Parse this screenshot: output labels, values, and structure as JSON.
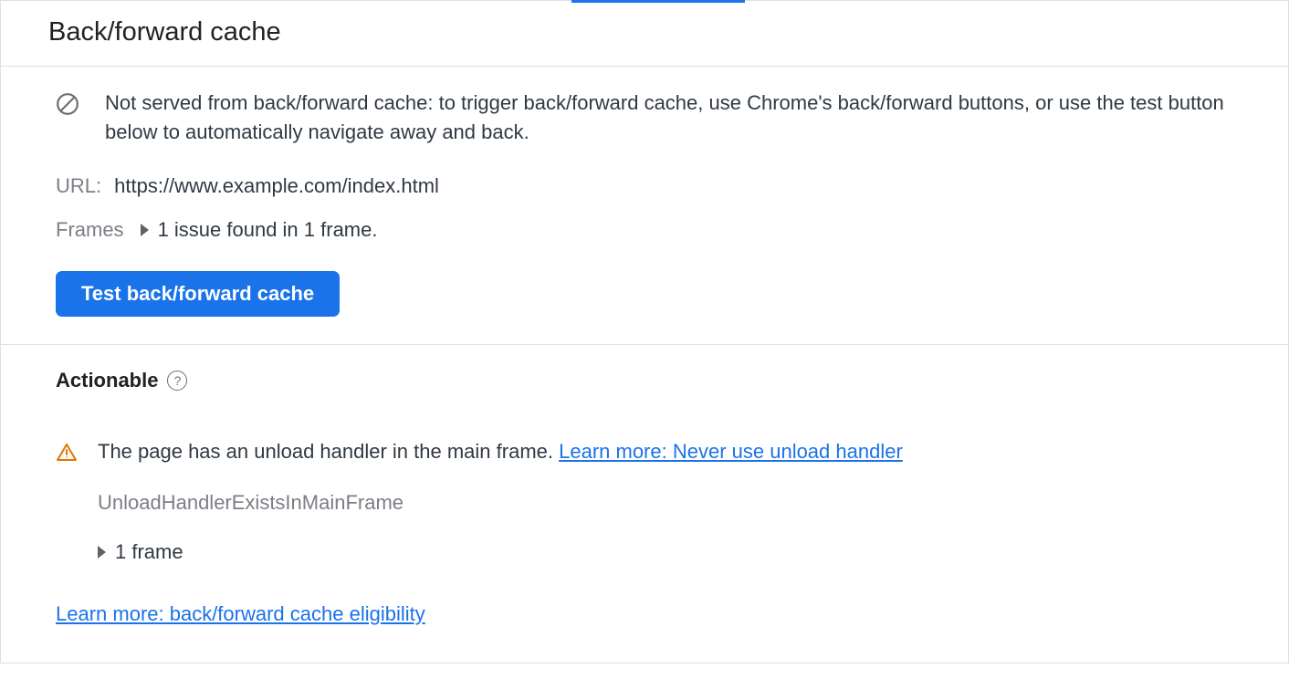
{
  "header": {
    "title": "Back/forward cache"
  },
  "status": {
    "message": "Not served from back/forward cache: to trigger back/forward cache, use Chrome's back/forward buttons, or use the test button below to automatically navigate away and back.",
    "icon": "blocked-circle-icon",
    "url_label": "URL:",
    "url_value": "https://www.example.com/index.html",
    "frames_label": "Frames",
    "frames_summary": "1 issue found in 1 frame.",
    "test_button": "Test back/forward cache"
  },
  "actionable": {
    "heading": "Actionable",
    "help_symbol": "?",
    "issue": {
      "text_prefix": "The page has an unload handler in the main frame. ",
      "learn_more_label": "Learn more: Never use unload handler",
      "code": "UnloadHandlerExistsInMainFrame",
      "frame_count": "1 frame"
    },
    "eligibility_link": "Learn more: back/forward cache eligibility"
  },
  "colors": {
    "accent": "#1a73e8",
    "warning": "#e37400"
  }
}
